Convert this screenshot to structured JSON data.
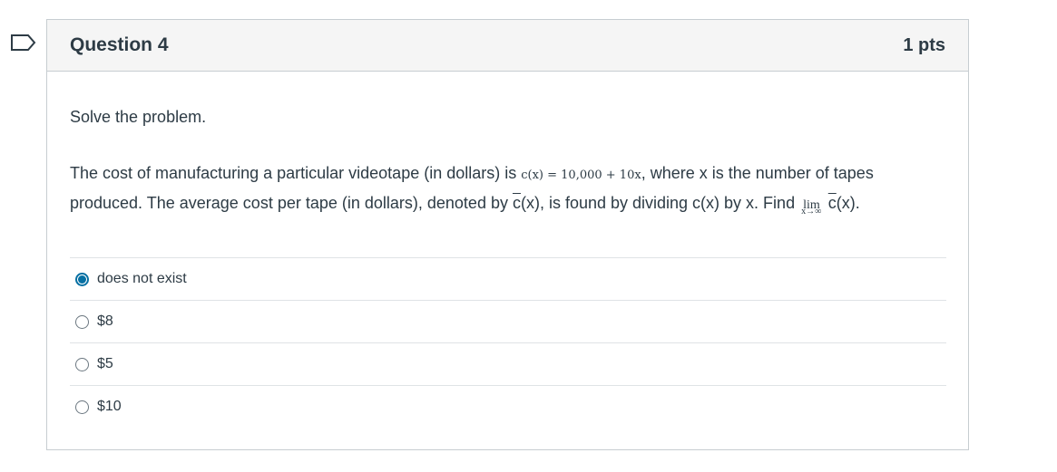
{
  "question": {
    "title": "Question 4",
    "points": "1 pts",
    "instruction": "Solve the problem.",
    "problem": {
      "text_before": "The cost of manufacturing a particular videotape (in dollars) is ",
      "formula": "c(x) = 10,000 + 10x",
      "text_middle": ", where x is the number of tapes produced. The average cost per tape (in dollars), denoted by ",
      "cbar_symbol": "c",
      "cbar_arg": "(x), is found by dividing c(x) by x. Find ",
      "lim_word": "lim",
      "lim_sub": "x→∞",
      "text_end_symbol": "c",
      "text_end": "(x)."
    },
    "answers": [
      {
        "label": "does not exist",
        "selected": true
      },
      {
        "label": "$8",
        "selected": false
      },
      {
        "label": "$5",
        "selected": false
      },
      {
        "label": "$10",
        "selected": false
      }
    ]
  },
  "colors": {
    "accent": "#0770a3",
    "text": "#2d3b45",
    "header_bg": "#f5f5f5",
    "border": "#c7cdd1"
  }
}
